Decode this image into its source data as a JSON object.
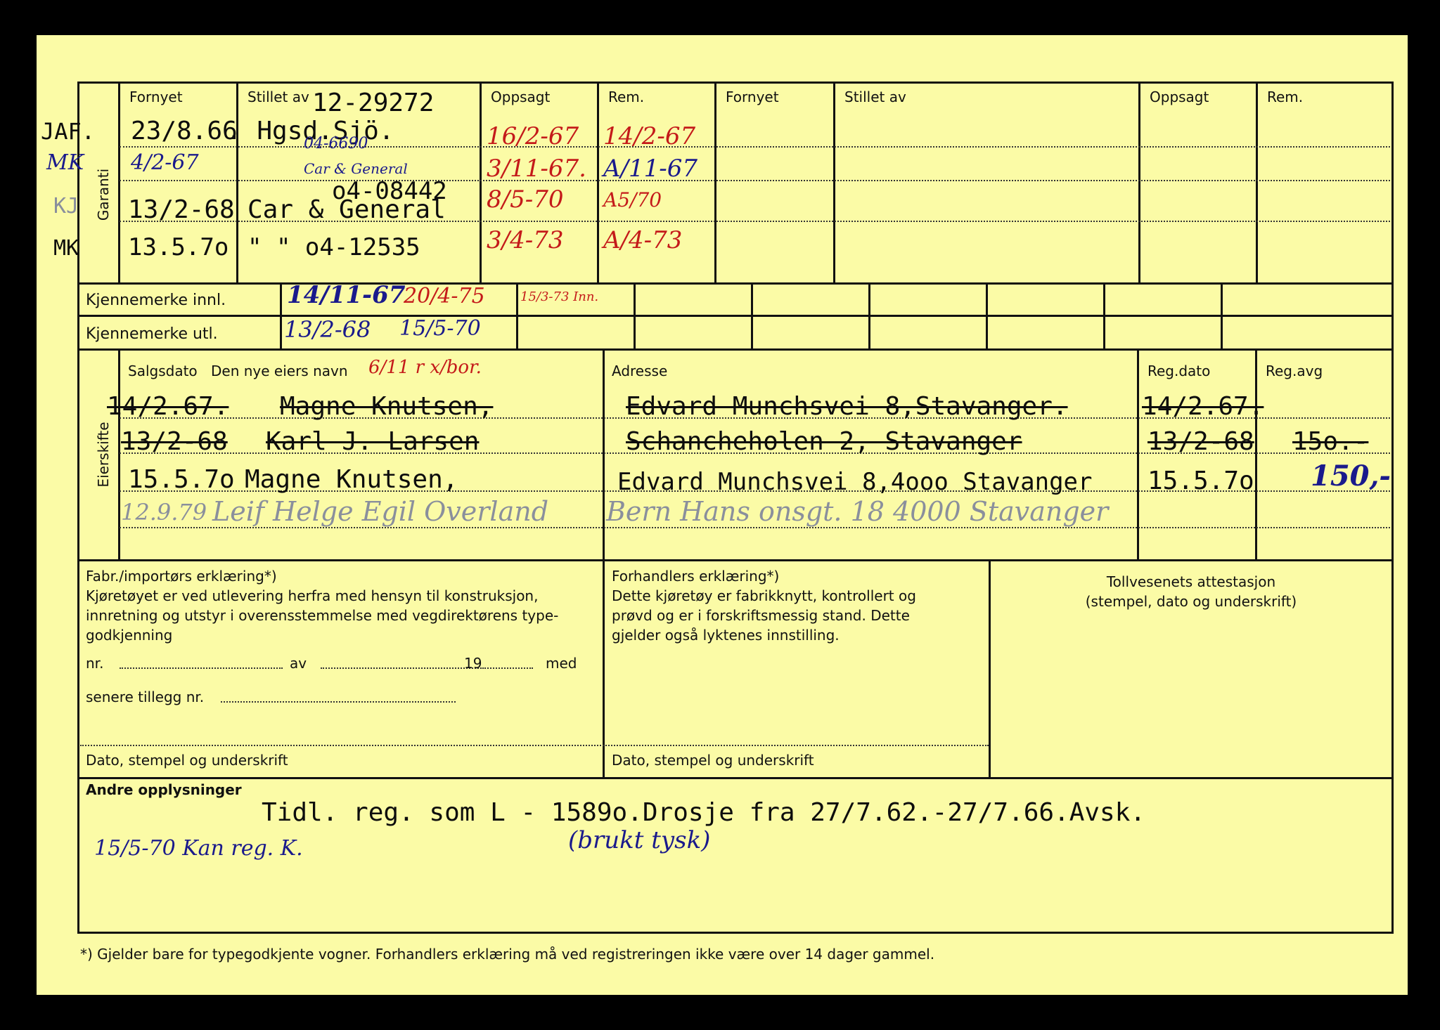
{
  "colors": {
    "card": "#fbfba6",
    "ink": "#0d0d0d",
    "blue_ink": "#1a1a8c",
    "red_ink": "#c41a1a",
    "faded_ink": "#8a8f9c"
  },
  "guarantee": {
    "side_label": "Garanti",
    "headers": {
      "fornyet": "Fornyet",
      "stillet_av": "Stillet av",
      "oppsagt": "Oppsagt",
      "rem": "Rem."
    },
    "margin_marks": [
      "JAF.",
      "MK",
      "KJ",
      "MK"
    ],
    "rows": [
      {
        "fornyet": "23/8.66",
        "stillet_av": ". Hgsd.Sjö.",
        "note_top": "12-29272",
        "oppsagt": "16/2-67",
        "rem": "14/2-67"
      },
      {
        "fornyet": "4/2-67",
        "stillet_av": "Car & General",
        "note_top": "04-6690",
        "oppsagt": "3/11-67.",
        "rem": "A/11-67"
      },
      {
        "fornyet": "13/2-68",
        "stillet_av": "Car & General",
        "note_top": "o4-08442",
        "oppsagt": "8/5-70",
        "rem": "A5/70"
      },
      {
        "fornyet": "13.5.7o",
        "stillet_av": "\"     \"  o4-12535",
        "oppsagt": "3/4-73",
        "rem": "A/4-73"
      }
    ]
  },
  "plates": {
    "innl_label": "Kjennemerke innl.",
    "utl_label": "Kjennemerke utl.",
    "innl": [
      "14/11-67",
      "20/4-75",
      "15/3-73 Inn."
    ],
    "utl": [
      "13/2-68",
      "15/5-70"
    ]
  },
  "owners": {
    "side_label": "Eierskifte",
    "headers": {
      "salgsdato": "Salgsdato",
      "navn": "Den nye eiers navn",
      "adresse": "Adresse",
      "regdato": "Reg.dato",
      "regavg": "Reg.avg"
    },
    "navn_note": "6/11 r  x/bor.",
    "rows": [
      {
        "salgsdato": "14/2.67.",
        "navn": "Magne Knutsen,",
        "adresse": "Edvard Munchsvei 8,Stavanger.",
        "regdato": "14/2.67.",
        "regavg": ""
      },
      {
        "salgsdato": "13/2-68",
        "navn": "Karl J. Larsen",
        "adresse": "Schancheholen 2, Stavanger",
        "regdato": "13/2-68",
        "regavg": "15o.-"
      },
      {
        "salgsdato": "15.5.7o",
        "navn": "Magne Knutsen,",
        "adresse": "Edvard Munchsvei 8,4ooo Stavanger",
        "regdato": "15.5.7o",
        "regavg": "150,-"
      },
      {
        "salgsdato": "12.9.79",
        "navn": "Leif Helge Egil Overland",
        "adresse": "Bern Hans onsgt. 18  4000 Stavanger",
        "regdato": "",
        "regavg": ""
      }
    ]
  },
  "declarations": {
    "fabr_title": "Fabr./importørs erklæring*)",
    "fabr_lines": [
      "Kjøretøyet er ved utlevering herfra med hensyn til konstruksjon,",
      "innretning og utstyr i overensstemmelse med vegdirektørens type-",
      "godkjenning"
    ],
    "nr_label": "nr.",
    "av_label": "av",
    "year_label": "19",
    "med_label": "med",
    "senere_label": "senere tillegg nr.",
    "forhandler_title": "Forhandlers erklæring*)",
    "forhandler_lines": [
      "Dette kjøretøy er fabrikknytt, kontrollert og",
      "prøvd og er i forskriftsmessig stand. Dette",
      "gjelder også lyktenes innstilling."
    ],
    "toll_title": "Tollvesenets attestasjon",
    "toll_sub": "(stempel, dato og underskrift)",
    "dato_label": "Dato, stempel og underskrift"
  },
  "other": {
    "label": "Andre opplysninger",
    "typed": "Tidl. reg. som L - 1589o.Drosje fra 27/7.62.-27/7.66.Avsk.",
    "hand_note": "(brukt tysk)",
    "hand_left": "15/5-70 Kan reg. K."
  },
  "footnote": "*)  Gjelder bare for typegodkjente vogner.  Forhandlers erklæring må ved registreringen ikke være over 14 dager gammel."
}
